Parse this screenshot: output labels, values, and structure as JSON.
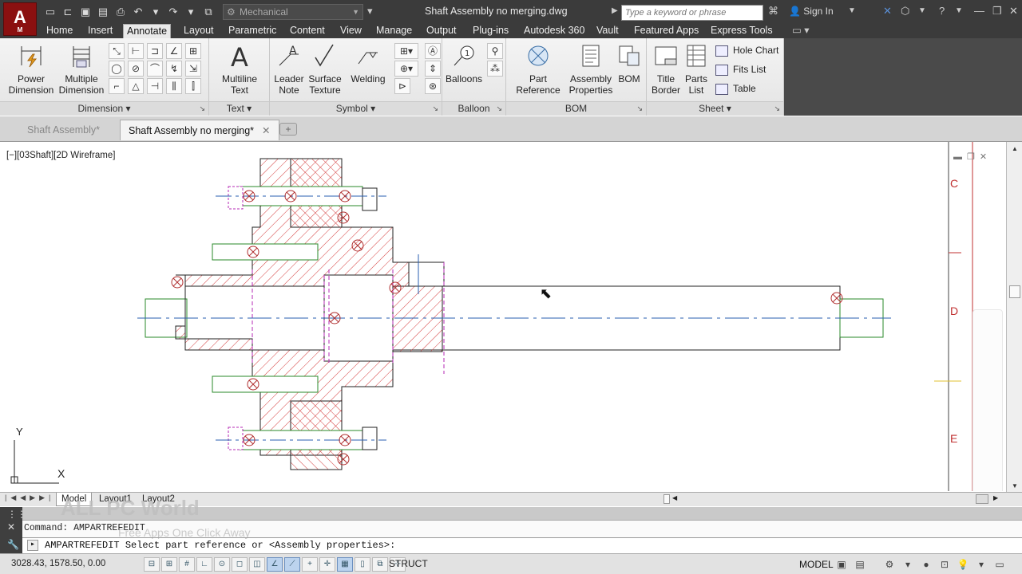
{
  "app": {
    "logo_letter": "A",
    "logo_sub": "M"
  },
  "title": {
    "workspace": "Mechanical",
    "document": "Shaft Assembly no merging.dwg",
    "search_placeholder": "Type a keyword or phrase",
    "sign_in": "Sign In"
  },
  "ribbon_tabs": [
    "Home",
    "Insert",
    "Annotate",
    "Layout",
    "Parametric",
    "Content",
    "View",
    "Manage",
    "Output",
    "Plug-ins",
    "Autodesk 360",
    "Vault",
    "Featured Apps",
    "Express Tools"
  ],
  "ribbon": {
    "dimension": {
      "title": "Dimension",
      "power": [
        "Power",
        "Dimension"
      ],
      "multiple": [
        "Multiple",
        "Dimension"
      ]
    },
    "text": {
      "title": "Text",
      "multiline": [
        "Multiline",
        "Text"
      ]
    },
    "symbol": {
      "title": "Symbol",
      "leader": [
        "Leader",
        "Note"
      ],
      "surface": [
        "Surface",
        "Texture"
      ],
      "welding": "Welding"
    },
    "balloon": {
      "title": "Balloon",
      "balloons": "Balloons"
    },
    "bom": {
      "title": "BOM",
      "part_ref": [
        "Part",
        "Reference"
      ],
      "assembly": [
        "Assembly",
        "Properties"
      ],
      "bom": "BOM"
    },
    "sheet": {
      "title": "Sheet",
      "title_border": [
        "Title",
        "Border"
      ],
      "parts_list": [
        "Parts",
        "List"
      ],
      "hole_chart": "Hole Chart",
      "fits_list": "Fits List",
      "table": "Table"
    }
  },
  "file_tabs": [
    {
      "label": "Shaft Assembly*"
    },
    {
      "label": "Shaft Assembly no merging*"
    }
  ],
  "viewport": {
    "label": "[−][03Shaft][2D Wireframe]",
    "ucs_y": "Y",
    "ucs_x": "X",
    "border_letters": [
      "C",
      "D",
      "E"
    ]
  },
  "layout_tabs": [
    "Model",
    "Layout1",
    "Layout2"
  ],
  "command": {
    "history": "Command: AMPARTREFEDIT",
    "prompt": "AMPARTREFEDIT Select part reference or <Assembly properties>:"
  },
  "status": {
    "coords": "3028.43, 1578.50, 0.00",
    "struct": "STRUCT",
    "model": "MODEL"
  },
  "watermark": {
    "title": "ALL PC World",
    "subtitle": "Free Apps One Click Away"
  }
}
